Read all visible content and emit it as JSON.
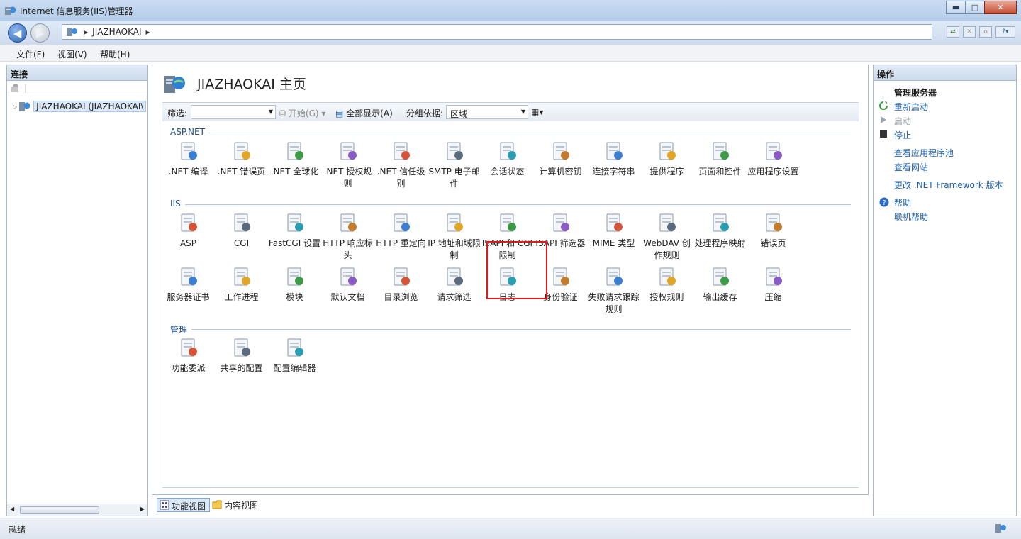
{
  "window": {
    "title": "Internet 信息服务(IIS)管理器"
  },
  "address": {
    "crumbs": [
      "JIAZHAOKAI"
    ]
  },
  "menu": [
    {
      "label": "文件(F)"
    },
    {
      "label": "视图(V)"
    },
    {
      "label": "帮助(H)"
    }
  ],
  "connections": {
    "header": "连接",
    "tree_item": "JIAZHAOKAI (JIAZHAOKAI\\"
  },
  "page": {
    "title": "JIAZHAOKAI 主页"
  },
  "filter": {
    "label": "筛选:",
    "go": "开始(G)",
    "show_all": "全部显示(A)",
    "group_label": "分组依据:",
    "group_value": "区域"
  },
  "groups": [
    {
      "name": "ASP.NET",
      "items": [
        ".NET 编译",
        ".NET 错误页",
        ".NET 全球化",
        ".NET 授权规则",
        ".NET 信任级别",
        "SMTP 电子邮件",
        "会话状态",
        "计算机密钥",
        "连接字符串",
        "提供程序",
        "页面和控件",
        "应用程序设置"
      ]
    },
    {
      "name": "IIS",
      "items": [
        "ASP",
        "CGI",
        "FastCGI 设置",
        "HTTP 响应标头",
        "HTTP 重定向",
        "IP 地址和域限制",
        "ISAPI 和 CGI 限制",
        "ISAPI 筛选器",
        "MIME 类型",
        "WebDAV 创作规则",
        "处理程序映射",
        "错误页",
        "服务器证书",
        "工作进程",
        "模块",
        "默认文档",
        "目录浏览",
        "请求筛选",
        "日志",
        "身份验证",
        "失败请求跟踪规则",
        "授权规则",
        "输出缓存",
        "压缩"
      ]
    },
    {
      "name": "管理",
      "items": [
        "功能委派",
        "共享的配置",
        "配置编辑器"
      ]
    }
  ],
  "view_tabs": {
    "features": "功能视图",
    "content": "内容视图"
  },
  "actions": {
    "header": "操作",
    "manage_server": "管理服务器",
    "restart": "重新启动",
    "start": "启动",
    "stop": "停止",
    "view_app_pools": "查看应用程序池",
    "view_sites": "查看网站",
    "change_framework": "更改 .NET Framework 版本",
    "help": "帮助",
    "online_help": "联机帮助"
  },
  "status": {
    "text": "就绪"
  },
  "colors": {
    "accent": "#1f5fa8",
    "selection_border": "#e01a1a",
    "group_label": "#1f4e8a"
  }
}
